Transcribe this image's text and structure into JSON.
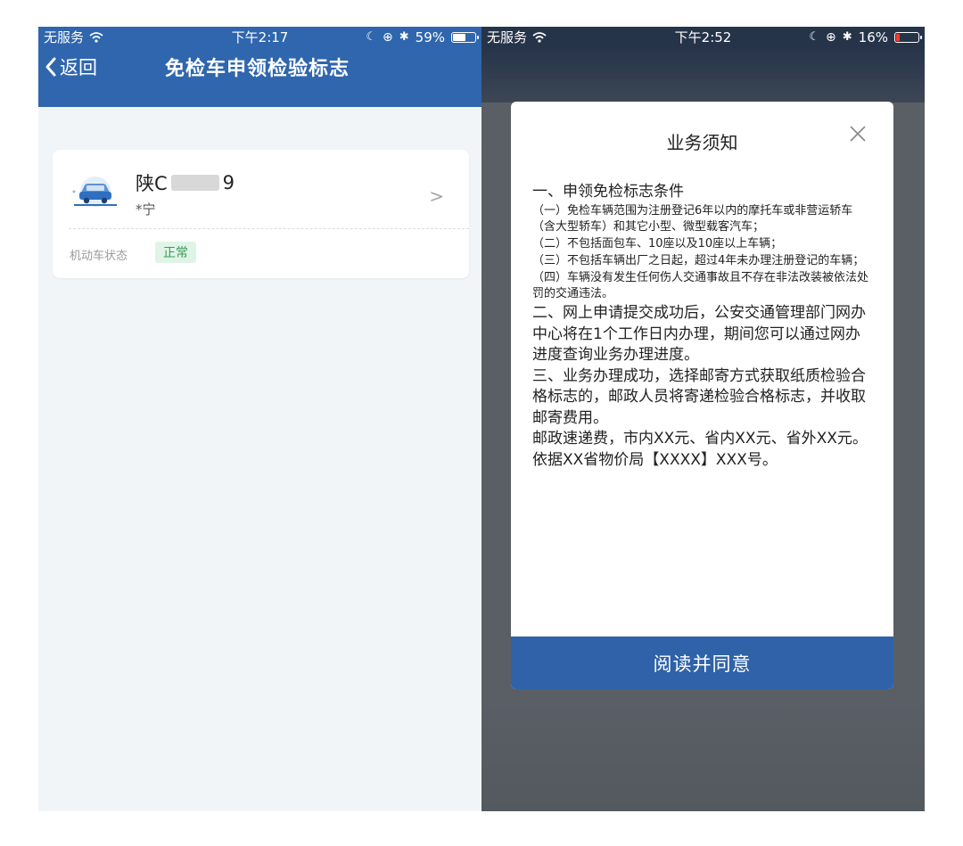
{
  "left_screen": {
    "statusbar": {
      "carrier": "无服务",
      "time": "下午2:17",
      "battery": "59%",
      "battery_level": 0.59
    },
    "navbar": {
      "back_label": "返回",
      "title": "免检车申领检验标志"
    },
    "vehicle_card": {
      "plate_prefix": "陕C",
      "plate_suffix": "9",
      "owner": "*宁",
      "status_label": "机动车状态",
      "status_value": "正常",
      "chevron": ">"
    }
  },
  "right_screen": {
    "statusbar": {
      "carrier": "无服务",
      "time": "下午2:52",
      "battery": "16%",
      "battery_level": 0.16
    },
    "modal": {
      "title": "业务须知",
      "paragraphs": [
        {
          "size": "lg",
          "text": "一、申领免检标志条件"
        },
        {
          "size": "sm",
          "text": "（一）免检车辆范围为注册登记6年以内的摩托车或非营运轿车（含大型轿车）和其它小型、微型载客汽车；"
        },
        {
          "size": "sm",
          "text": "（二）不包括面包车、10座以及10座以上车辆；"
        },
        {
          "size": "sm",
          "text": "（三）不包括车辆出厂之日起，超过4年未办理注册登记的车辆；"
        },
        {
          "size": "sm",
          "text": "（四）车辆没有发生任何伤人交通事故且不存在非法改装被依法处罚的交通违法。"
        },
        {
          "size": "lg",
          "text": "二、网上申请提交成功后，公安交通管理部门网办中心将在1个工作日内办理，期间您可以通过网办进度查询业务办理进度。"
        },
        {
          "size": "lg",
          "text": "三、业务办理成功，选择邮寄方式获取纸质检验合格标志的，邮政人员将寄递检验合格标志，并收取邮寄费用。"
        },
        {
          "size": "lg",
          "text": "邮政速递费，市内XX元、省内XX元、省外XX元。依据XX省物价局【XXXX】XXX号。"
        }
      ],
      "agree_button": "阅读并同意"
    }
  },
  "icons": [
    "wifi-icon",
    "moon-icon",
    "lock-rotation-icon",
    "bluetooth-icon",
    "battery-icon",
    "back-chevron-icon",
    "car-icon",
    "close-icon"
  ],
  "colors": {
    "nav_blue": "#2f66ad",
    "button_blue": "#2f62a8",
    "status_green": "#3b9a57",
    "status_green_bg": "#dff4e6",
    "battery_low": "#ff3b30"
  }
}
